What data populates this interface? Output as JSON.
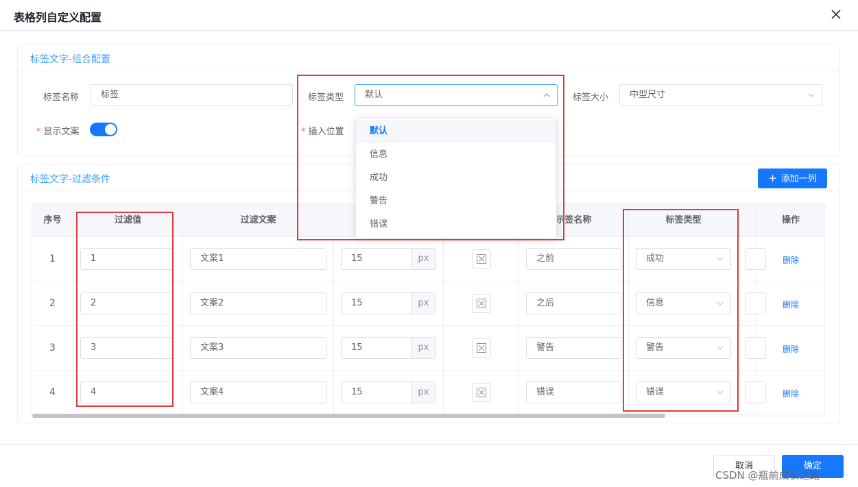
{
  "dialog": {
    "title": "表格列自定义配置",
    "close_icon": "close-icon"
  },
  "section1": {
    "title": "标签文字-组合配置",
    "name_label": "标签名称",
    "name_value": "标签",
    "type_label": "标签类型",
    "type_value": "默认",
    "size_label": "标签大小",
    "size_value": "中型尺寸",
    "show_text_label": "显示文案",
    "show_text_on": true,
    "insert_pos_label": "插入位置",
    "required_mark": "*"
  },
  "dropdown": {
    "options": [
      "默认",
      "信息",
      "成功",
      "警告",
      "错误"
    ],
    "selected": "默认"
  },
  "section2": {
    "title": "标签文字-过滤条件",
    "add_button": "添加一列",
    "add_icon": "plus-icon"
  },
  "table": {
    "headers": [
      "序号",
      "过滤值",
      "过滤文案",
      "",
      "",
      "示签名称",
      "标签类型",
      "",
      "操作"
    ],
    "unit": "px",
    "delete_label": "删除",
    "rows": [
      {
        "index": "1",
        "filter_value": "1",
        "filter_text": "文案1",
        "size": "15",
        "tag_name": "之前",
        "tag_type": "成功"
      },
      {
        "index": "2",
        "filter_value": "2",
        "filter_text": "文案2",
        "size": "15",
        "tag_name": "之后",
        "tag_type": "信息"
      },
      {
        "index": "3",
        "filter_value": "3",
        "filter_text": "文案3",
        "size": "15",
        "tag_name": "警告",
        "tag_type": "警告"
      },
      {
        "index": "4",
        "filter_value": "4",
        "filter_text": "文案4",
        "size": "15",
        "tag_name": "错误",
        "tag_type": "错误"
      }
    ]
  },
  "footer": {
    "cancel": "取消",
    "confirm": "确定",
    "watermark": "CSDN @瓶前成长之路"
  },
  "colors": {
    "primary": "#1677ff",
    "highlight_border": "#e0393e",
    "section_title": "#409eff"
  }
}
